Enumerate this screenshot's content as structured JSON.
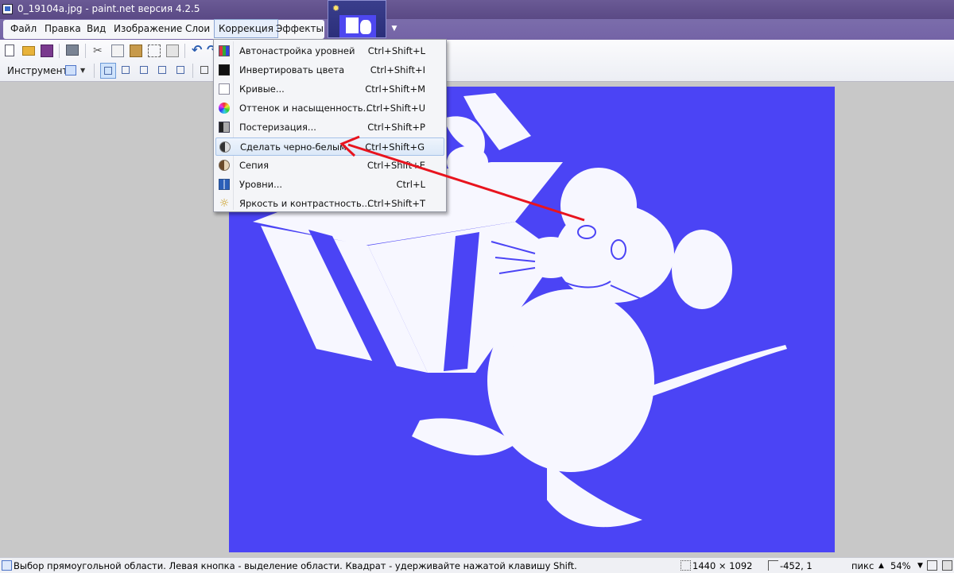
{
  "window": {
    "title": "0_19104a.jpg - paint.net версия 4.2.5"
  },
  "menubar": {
    "items": [
      {
        "label": "Файл"
      },
      {
        "label": "Правка"
      },
      {
        "label": "Вид"
      },
      {
        "label": "Изображение"
      },
      {
        "label": "Слои"
      },
      {
        "label": "Коррекция",
        "active": true
      },
      {
        "label": "Эффекты"
      }
    ]
  },
  "toolbar": {
    "tool_label": "Инструмент:"
  },
  "adjustments_menu": {
    "items": [
      {
        "label": "Автонастройка уровней",
        "shortcut": "Ctrl+Shift+L",
        "icon": "auto-level-icon"
      },
      {
        "label": "Инвертировать цвета",
        "shortcut": "Ctrl+Shift+I",
        "icon": "invert-colors-icon"
      },
      {
        "label": "Кривые...",
        "shortcut": "Ctrl+Shift+M",
        "icon": "curves-icon"
      },
      {
        "label": "Оттенок и насыщенность...",
        "shortcut": "Ctrl+Shift+U",
        "icon": "hue-saturation-icon"
      },
      {
        "label": "Постеризация...",
        "shortcut": "Ctrl+Shift+P",
        "icon": "posterize-icon"
      },
      {
        "label": "Сделать черно-белым",
        "shortcut": "Ctrl+Shift+G",
        "icon": "black-and-white-icon",
        "highlighted": true
      },
      {
        "label": "Сепия",
        "shortcut": "Ctrl+Shift+E",
        "icon": "sepia-icon"
      },
      {
        "label": "Уровни...",
        "shortcut": "Ctrl+L",
        "icon": "levels-icon"
      },
      {
        "label": "Яркость и контрастность...",
        "shortcut": "Ctrl+Shift+T",
        "icon": "brightness-contrast-icon"
      }
    ]
  },
  "statusbar": {
    "hint": "Выбор прямоугольной области. Левая кнопка - выделение области. Квадрат - удерживайте нажатой клавишу Shift.",
    "image_size": "1440 × 1092",
    "cursor_position": "-452, 1",
    "units": "пикс",
    "zoom": "54%"
  },
  "colors": {
    "canvas_bg": "#4b44f5",
    "annotation_arrow": "#e8141e",
    "titlebar": "#5a4985"
  }
}
